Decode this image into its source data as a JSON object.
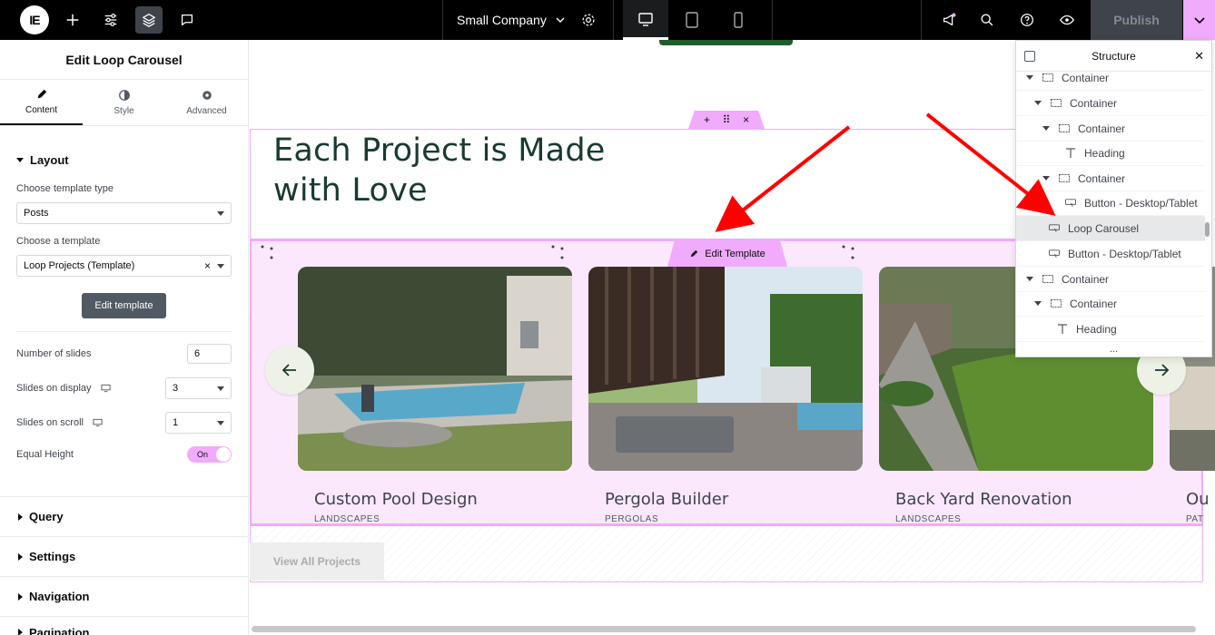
{
  "topbar": {
    "logo_text": "IE",
    "site_name": "Small Company",
    "publish_label": "Publish"
  },
  "panel": {
    "title": "Edit Loop Carousel",
    "tabs": [
      {
        "label": "Content",
        "icon": "pencil-icon",
        "active": true
      },
      {
        "label": "Style",
        "icon": "half-circle-icon",
        "active": false
      },
      {
        "label": "Advanced",
        "icon": "gear-icon",
        "active": false
      }
    ],
    "layout_section": "Layout",
    "template_type_label": "Choose template type",
    "template_type_value": "Posts",
    "template_label": "Choose a template",
    "template_value": "Loop Projects (Template)",
    "edit_template_button": "Edit template",
    "number_of_slides_label": "Number of slides",
    "number_of_slides_value": "6",
    "slides_on_display_label": "Slides on display",
    "slides_on_display_value": "3",
    "slides_on_scroll_label": "Slides on scroll",
    "slides_on_scroll_value": "1",
    "equal_height_label": "Equal Height",
    "equal_height_value": "On",
    "sections": [
      "Query",
      "Settings",
      "Navigation",
      "Pagination"
    ]
  },
  "canvas": {
    "heading_line1": "Each Project is Made",
    "heading_line2": "with Love",
    "edit_template_tag": "Edit Template",
    "cards": [
      {
        "title": "Custom Pool Design",
        "category": "LANDSCAPES"
      },
      {
        "title": "Pergola Builder",
        "category": "PERGOLAS"
      },
      {
        "title": "Back Yard Renovation",
        "category": "LANDSCAPES"
      },
      {
        "title": "Ou",
        "category": "PAT"
      }
    ],
    "view_all_button": "View All Projects"
  },
  "structure": {
    "title": "Structure",
    "items": [
      {
        "label": "Container",
        "type": "container",
        "expanded": true
      },
      {
        "label": "Container",
        "type": "container",
        "expanded": true
      },
      {
        "label": "Container",
        "type": "container",
        "expanded": true
      },
      {
        "label": "Heading",
        "type": "heading"
      },
      {
        "label": "Container",
        "type": "container",
        "expanded": true
      },
      {
        "label": "Button - Desktop/Tablet",
        "type": "button"
      },
      {
        "label": "Loop Carousel",
        "type": "carousel",
        "selected": true
      },
      {
        "label": "Button - Desktop/Tablet",
        "type": "button"
      },
      {
        "label": "Container",
        "type": "container",
        "expanded": true
      },
      {
        "label": "Container",
        "type": "container",
        "expanded": true
      },
      {
        "label": "Heading",
        "type": "heading"
      }
    ],
    "more": "..."
  },
  "colors": {
    "accent": "#f0abfc",
    "heading": "#193a30",
    "annotation": "#ff0000"
  }
}
